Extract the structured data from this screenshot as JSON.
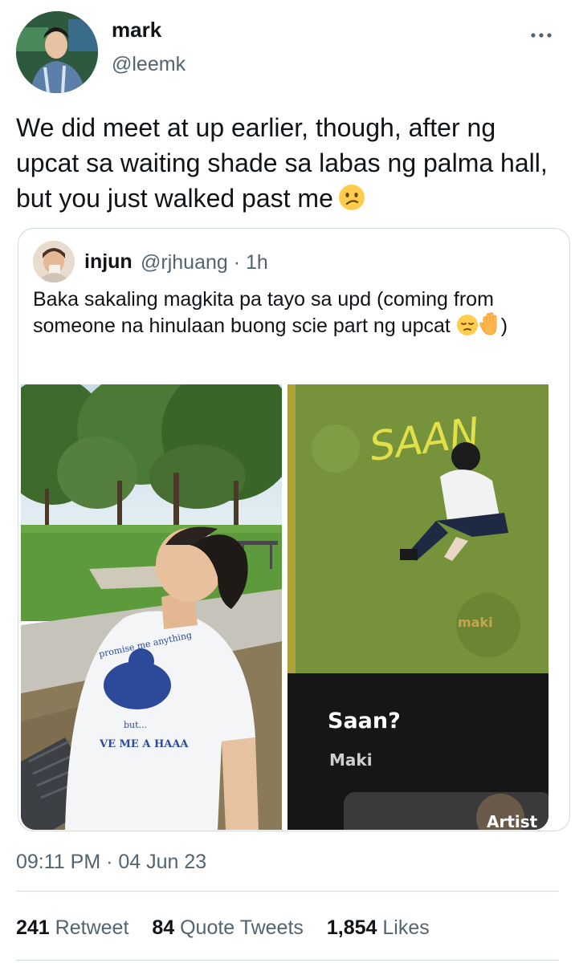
{
  "author": {
    "display_name": "mark",
    "handle": "@leemk"
  },
  "tweet": {
    "text": "We did meet at up earlier, though, after ng upcat sa waiting shade sa labas ng palma hall, but you just walked past me",
    "emoji": "confused-face"
  },
  "quoted": {
    "display_name": "injun",
    "handle": "@rjhuang",
    "separator": " · ",
    "time": "1h",
    "text": "Baka sakaling magkita pa tayo sa upd (coming from someone na hinulaan buong scie part ng upcat ",
    "text_end": ")",
    "emojis": [
      "pensive-face",
      "raised-hand"
    ],
    "images": [
      {
        "name": "photo-boy-in-park",
        "shirt_text_1": "promise me anything",
        "shirt_text_2": "but...",
        "shirt_text_3": "VE ME A HAAA"
      },
      {
        "name": "phone-music-screen",
        "cover_text": "SAAN",
        "cover_small": "maki",
        "song_title": "Saan?",
        "artist": "Maki",
        "partial_label": "Artist"
      }
    ]
  },
  "meta": {
    "time": "09:11 PM",
    "separator": " · ",
    "date": "04 Jun 23"
  },
  "stats": {
    "retweets_count": "241",
    "retweets_label": "Retweet",
    "quotes_count": "84",
    "quotes_label": "Quote Tweets",
    "likes_count": "1,854",
    "likes_label": "Likes"
  },
  "colors": {
    "text": "#0f1419",
    "secondary": "#536471",
    "border": "#cfd9de"
  }
}
